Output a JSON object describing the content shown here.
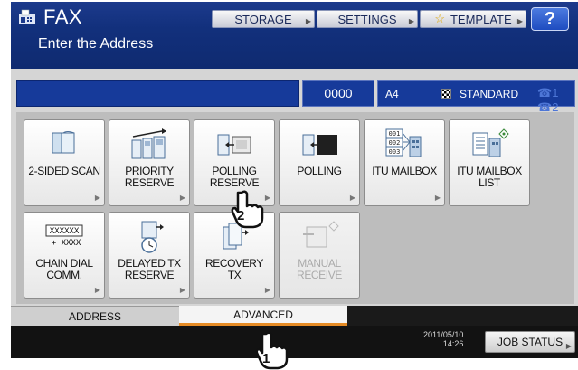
{
  "header": {
    "title": "FAX",
    "subtitle": "Enter the Address",
    "storage_label": "STORAGE",
    "settings_label": "SETTINGS",
    "template_label": "TEMPLATE",
    "help_label": "?"
  },
  "address_bar": {
    "count": "0000",
    "paper_size": "A4",
    "mode": "STANDARD",
    "line1": "☎1",
    "line2": "☎2"
  },
  "functions": [
    {
      "label_line1": "2-SIDED SCAN",
      "label_line2": "",
      "icon": "duplex-scan-icon"
    },
    {
      "label_line1": "PRIORITY",
      "label_line2": "RESERVE",
      "icon": "priority-reserve-icon"
    },
    {
      "label_line1": "POLLING",
      "label_line2": "RESERVE",
      "icon": "polling-reserve-icon"
    },
    {
      "label_line1": "POLLING",
      "label_line2": "",
      "icon": "polling-icon"
    },
    {
      "label_line1": "ITU MAILBOX",
      "label_line2": "",
      "icon": "itu-mailbox-icon",
      "icon_text": [
        "001",
        "002",
        "003"
      ]
    },
    {
      "label_line1": "ITU MAILBOX",
      "label_line2": "LIST",
      "icon": "itu-mailbox-list-icon"
    },
    {
      "label_line1": "CHAIN DIAL",
      "label_line2": "COMM.",
      "icon": "chain-dial-icon",
      "icon_text": [
        "XXXXXX",
        "+ XXXX"
      ]
    },
    {
      "label_line1": "DELAYED TX",
      "label_line2": "RESERVE",
      "icon": "delayed-tx-icon"
    },
    {
      "label_line1": "RECOVERY",
      "label_line2": "TX",
      "icon": "recovery-tx-icon"
    },
    {
      "label_line1": "MANUAL",
      "label_line2": "RECEIVE",
      "icon": "manual-receive-icon",
      "disabled": true
    }
  ],
  "tabs": {
    "address": "ADDRESS",
    "advanced": "ADVANCED"
  },
  "footer": {
    "date": "2011/05/10",
    "time": "14:26",
    "job_status": "JOB STATUS"
  },
  "callouts": {
    "step1": "1",
    "step2": "2"
  },
  "colors": {
    "header_blue": "#12307c",
    "active_tab_accent": "#e58b25",
    "help_blue": "#2a5ad0"
  }
}
